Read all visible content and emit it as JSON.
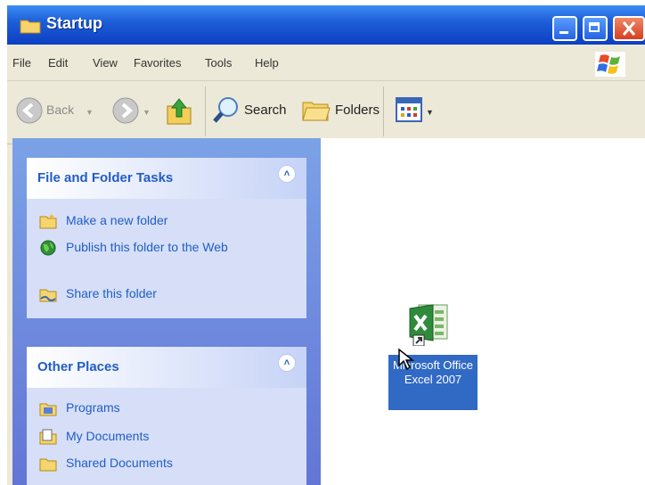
{
  "window": {
    "title": "Startup"
  },
  "menu": {
    "items": [
      "File",
      "Edit",
      "View",
      "Favorites",
      "Tools",
      "Help"
    ]
  },
  "toolbar": {
    "back_label": "Back",
    "search_label": "Search",
    "folders_label": "Folders"
  },
  "tasks_panel": {
    "title": "File and Folder Tasks",
    "items": [
      "Make a new folder",
      "Publish this folder to the Web",
      "Share this folder"
    ]
  },
  "places_panel": {
    "title": "Other Places",
    "items": [
      "Programs",
      "My Documents",
      "Shared Documents"
    ]
  },
  "content": {
    "file_label": "Microsoft Office Excel 2007"
  },
  "colors": {
    "titlebar": "#0c3fc2",
    "taskpane": "#6375d6",
    "panel_title": "#215dc6",
    "selection": "#316ac5"
  }
}
